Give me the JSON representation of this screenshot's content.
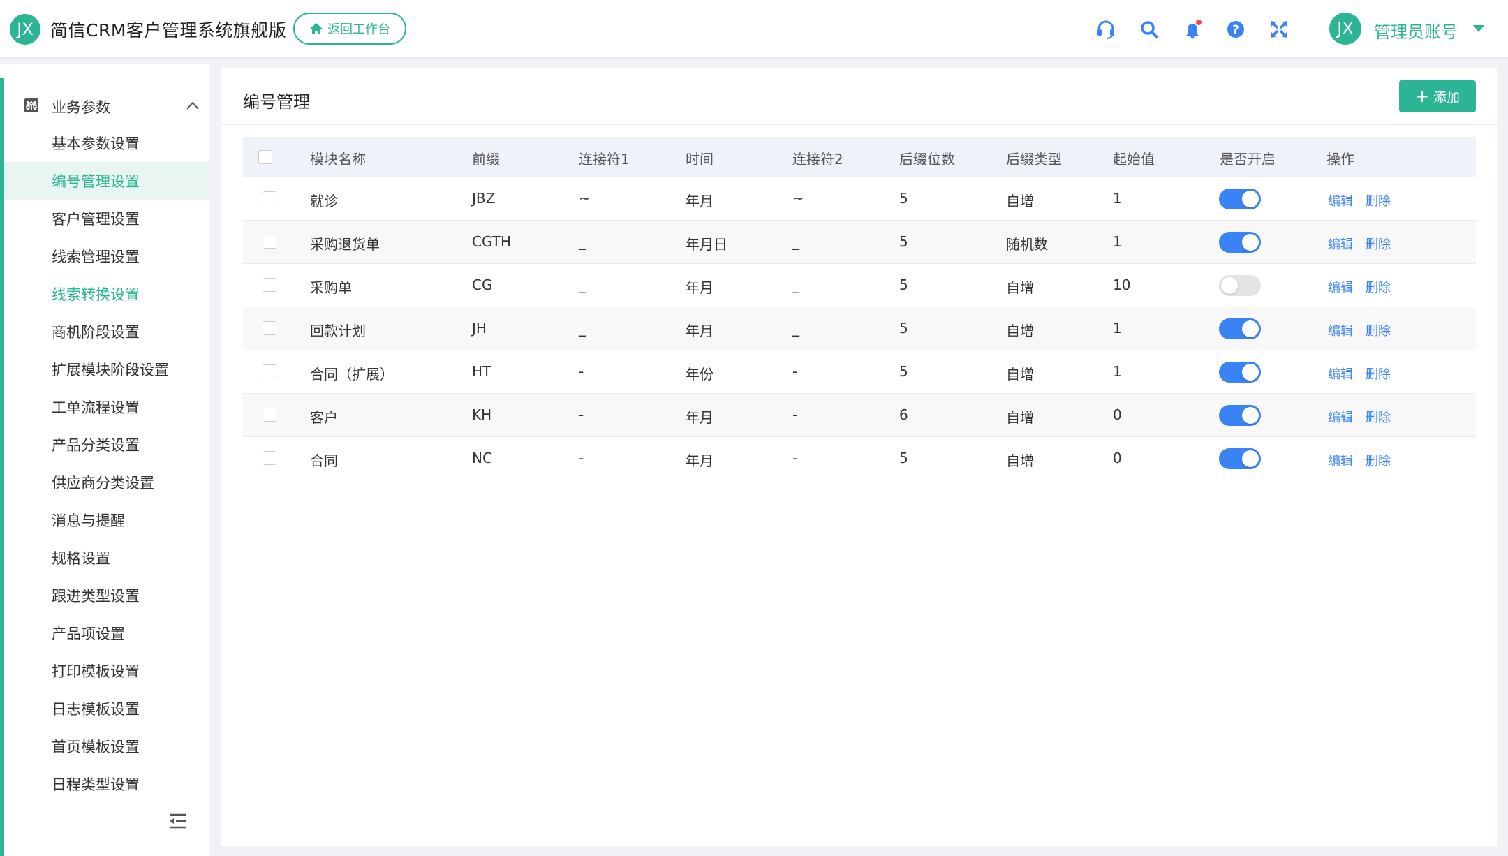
{
  "header": {
    "logo_text": "JX",
    "app_title": "简信CRM客户管理系统旗舰版",
    "home_button": "返回工作台",
    "user_avatar_text": "JX",
    "user_name": "管理员账号",
    "accent_color": "#2bb594",
    "icons": [
      "headset-icon",
      "search-icon",
      "bell-icon",
      "help-icon",
      "fullscreen-icon"
    ]
  },
  "sidebar": {
    "group_label": "业务参数",
    "items": [
      {
        "label": "基本参数设置"
      },
      {
        "label": "编号管理设置"
      },
      {
        "label": "客户管理设置"
      },
      {
        "label": "线索管理设置"
      },
      {
        "label": "线索转换设置"
      },
      {
        "label": "商机阶段设置"
      },
      {
        "label": "扩展模块阶段设置"
      },
      {
        "label": "工单流程设置"
      },
      {
        "label": "产品分类设置"
      },
      {
        "label": "供应商分类设置"
      },
      {
        "label": "消息与提醒"
      },
      {
        "label": "规格设置"
      },
      {
        "label": "跟进类型设置"
      },
      {
        "label": "产品项设置"
      },
      {
        "label": "打印模板设置"
      },
      {
        "label": "日志模板设置"
      },
      {
        "label": "首页模板设置"
      },
      {
        "label": "日程类型设置"
      }
    ],
    "active_item": "编号管理设置"
  },
  "main": {
    "title": "编号管理",
    "add_button": "添加",
    "columns": [
      "模块名称",
      "前缀",
      "连接符1",
      "时间",
      "连接符2",
      "后缀位数",
      "后缀类型",
      "起始值",
      "是否开启",
      "操作"
    ],
    "edit_label": "编辑",
    "delete_label": "删除",
    "rows": [
      {
        "name": "就诊",
        "prefix": "JBZ",
        "sep1": "~",
        "time": "年月",
        "sep2": "~",
        "digits": "5",
        "suffix_type": "自增",
        "start": "1",
        "enabled": true
      },
      {
        "name": "采购退货单",
        "prefix": "CGTH",
        "sep1": "_",
        "time": "年月日",
        "sep2": "_",
        "digits": "5",
        "suffix_type": "随机数",
        "start": "1",
        "enabled": true
      },
      {
        "name": "采购单",
        "prefix": "CG",
        "sep1": "_",
        "time": "年月",
        "sep2": "_",
        "digits": "5",
        "suffix_type": "自增",
        "start": "10",
        "enabled": false
      },
      {
        "name": "回款计划",
        "prefix": "JH",
        "sep1": "_",
        "time": "年月",
        "sep2": "_",
        "digits": "5",
        "suffix_type": "自增",
        "start": "1",
        "enabled": true
      },
      {
        "name": "合同（扩展）",
        "prefix": "HT",
        "sep1": "-",
        "time": "年份",
        "sep2": "-",
        "digits": "5",
        "suffix_type": "自增",
        "start": "1",
        "enabled": true
      },
      {
        "name": "客户",
        "prefix": "KH",
        "sep1": "-",
        "time": "年月",
        "sep2": "-",
        "digits": "6",
        "suffix_type": "自增",
        "start": "0",
        "enabled": true
      },
      {
        "name": "合同",
        "prefix": "NC",
        "sep1": "-",
        "time": "年月",
        "sep2": "-",
        "digits": "5",
        "suffix_type": "自增",
        "start": "0",
        "enabled": true
      }
    ]
  }
}
